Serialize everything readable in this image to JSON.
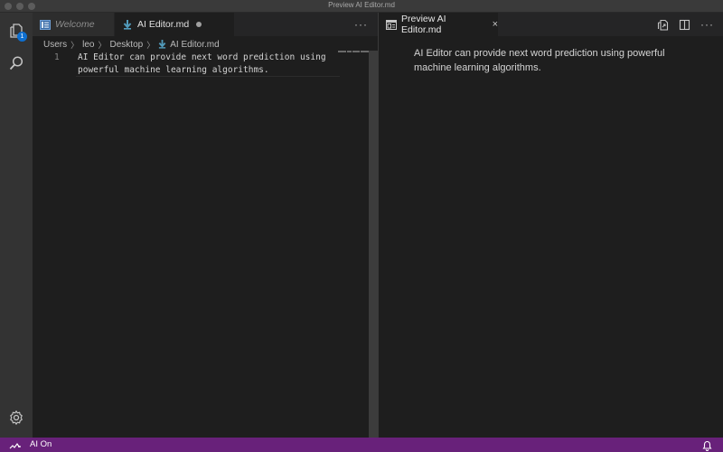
{
  "window": {
    "title": "Preview AI Editor.md"
  },
  "activity_bar": {
    "explorer_badge": "1",
    "icons": [
      "explorer-icon",
      "search-icon",
      "settings-gear-icon"
    ]
  },
  "editor_left": {
    "tabs": [
      {
        "label": "Welcome",
        "icon": "welcome-icon",
        "active": false
      },
      {
        "label": "AI Editor.md",
        "icon": "markdown-icon",
        "active": true,
        "dirty": true
      }
    ],
    "more_label": "···",
    "breadcrumb": [
      "Users",
      "leo",
      "Desktop",
      "AI Editor.md"
    ],
    "line_number": "1",
    "lines": [
      "AI Editor can provide next word prediction using",
      "powerful machine learning algorithms."
    ]
  },
  "editor_right": {
    "tab": {
      "label": "Preview AI Editor.md",
      "icon": "preview-icon",
      "close": "×"
    },
    "more_label": "···",
    "preview_text": "AI Editor can provide next word prediction using powerful machine learning algorithms."
  },
  "status_bar": {
    "label": "AI On",
    "color": "#68217a"
  }
}
